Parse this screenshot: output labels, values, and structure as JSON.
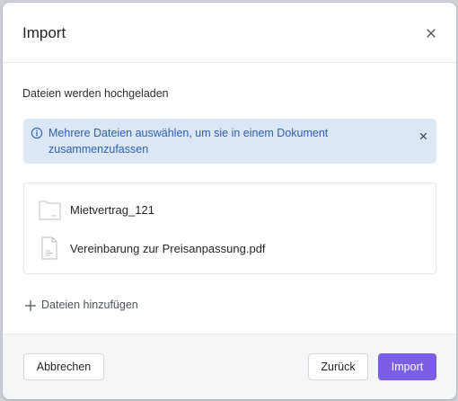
{
  "dialog": {
    "title": "Import",
    "close_icon": "close-icon"
  },
  "body": {
    "status_text": "Dateien werden hochgeladen",
    "banner": {
      "icon": "info-icon",
      "text": "Mehrere Dateien auswählen, um sie in einem Dokument zusammenzufassen",
      "close_icon": "close-icon",
      "color": "#2f5fb0",
      "background": "#dbe6f6"
    },
    "files": [
      {
        "icon": "folder-icon",
        "name": "Mietvertrag_121"
      },
      {
        "icon": "document-icon",
        "name": "Vereinbarung zur Preisanpassung.pdf"
      }
    ],
    "add_files_label": "Dateien hinzufügen"
  },
  "footer": {
    "cancel_label": "Abbrechen",
    "back_label": "Zurück",
    "import_label": "Import",
    "accent": "#7c5ee6"
  }
}
